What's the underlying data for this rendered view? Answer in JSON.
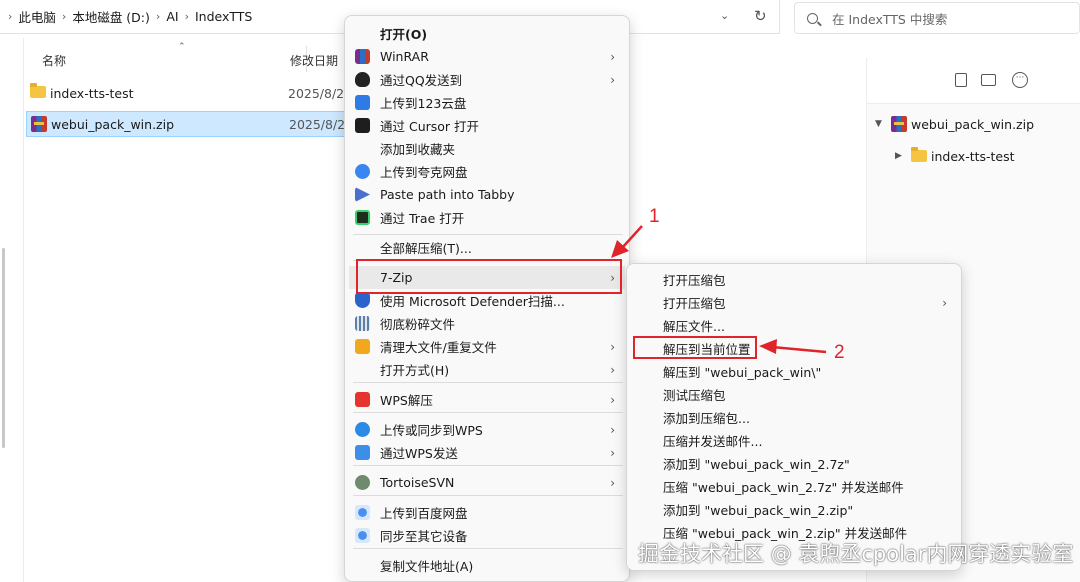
{
  "address_bar": {
    "breadcrumbs": [
      "此电脑",
      "本地磁盘 (D:)",
      "AI",
      "IndexTTS"
    ],
    "separator": "›"
  },
  "search": {
    "placeholder": "在 IndexTTS 中搜索"
  },
  "file_list": {
    "columns": [
      "名称",
      "修改日期"
    ],
    "rows": [
      {
        "name": "index-tts-test",
        "date": "2025/8/2",
        "icon": "folder-icon",
        "selected": false
      },
      {
        "name": "webui_pack_win.zip",
        "date": "2025/8/2",
        "icon": "zip-icon",
        "selected": true
      }
    ]
  },
  "preview": {
    "tree": [
      {
        "name": "webui_pack_win.zip",
        "expanded": true,
        "icon": "zip-icon"
      },
      {
        "name": "index-tts-test",
        "expanded": false,
        "icon": "folder-icon"
      }
    ]
  },
  "context_menu": {
    "items": [
      {
        "label": "打开(O)",
        "bold": true,
        "icon": "",
        "arrow": false
      },
      {
        "label": "WinRAR",
        "icon": "winrar-icon",
        "arrow": true
      },
      {
        "label": "通过QQ发送到",
        "icon": "qq-icon",
        "arrow": true
      },
      {
        "label": "上传到123云盘",
        "icon": "123pan-icon",
        "arrow": false
      },
      {
        "label": "通过 Cursor 打开",
        "icon": "cursor-icon",
        "arrow": false
      },
      {
        "label": "添加到收藏夹",
        "icon": "",
        "arrow": false
      },
      {
        "label": "上传到夸克网盘",
        "icon": "quark-icon",
        "arrow": false
      },
      {
        "label": "Paste path into Tabby",
        "icon": "tabby-icon",
        "arrow": false
      },
      {
        "label": "通过 Trae 打开",
        "icon": "trae-icon",
        "arrow": false
      },
      {
        "label": "全部解压缩(T)...",
        "icon": "",
        "arrow": false
      },
      {
        "label": "7-Zip",
        "icon": "",
        "arrow": true
      },
      {
        "label": "使用 Microsoft Defender扫描...",
        "icon": "defender-icon",
        "arrow": false
      },
      {
        "label": "彻底粉碎文件",
        "icon": "shredder-icon",
        "arrow": false
      },
      {
        "label": "清理大文件/重复文件",
        "icon": "cleaner-icon",
        "arrow": true
      },
      {
        "label": "打开方式(H)",
        "icon": "",
        "arrow": true
      },
      {
        "label": "WPS解压",
        "icon": "wps-icon",
        "arrow": true
      },
      {
        "label": "上传或同步到WPS",
        "icon": "wps-cloud-icon",
        "arrow": true
      },
      {
        "label": "通过WPS发送",
        "icon": "wps-send-icon",
        "arrow": true
      },
      {
        "label": "TortoiseSVN",
        "icon": "tortoisesvn-icon",
        "arrow": true
      },
      {
        "label": "上传到百度网盘",
        "icon": "baidu-icon",
        "arrow": false
      },
      {
        "label": "同步至其它设备",
        "icon": "sync-icon",
        "arrow": false
      },
      {
        "label": "复制文件地址(A)",
        "icon": "",
        "arrow": false
      }
    ]
  },
  "sevenzip_submenu": {
    "items": [
      {
        "label": "打开压缩包",
        "arrow": false
      },
      {
        "label": "打开压缩包",
        "arrow": true
      },
      {
        "label": "解压文件...",
        "arrow": false
      },
      {
        "label": "解压到当前位置",
        "arrow": false
      },
      {
        "label": "解压到 \"webui_pack_win\\\"",
        "arrow": false
      },
      {
        "label": "测试压缩包",
        "arrow": false
      },
      {
        "label": "添加到压缩包...",
        "arrow": false
      },
      {
        "label": "压缩并发送邮件...",
        "arrow": false
      },
      {
        "label": "添加到 \"webui_pack_win_2.7z\"",
        "arrow": false
      },
      {
        "label": "压缩 \"webui_pack_win_2.7z\" 并发送邮件",
        "arrow": false
      },
      {
        "label": "添加到 \"webui_pack_win_2.zip\"",
        "arrow": false
      },
      {
        "label": "压缩 \"webui_pack_win_2.zip\" 并发送邮件",
        "arrow": false
      }
    ]
  },
  "annotations": {
    "step1": "1",
    "step2": "2",
    "color": "#e0242b"
  },
  "watermark": "掘金技术社区 @ 袁煦丞cpolar内网穿透实验室"
}
